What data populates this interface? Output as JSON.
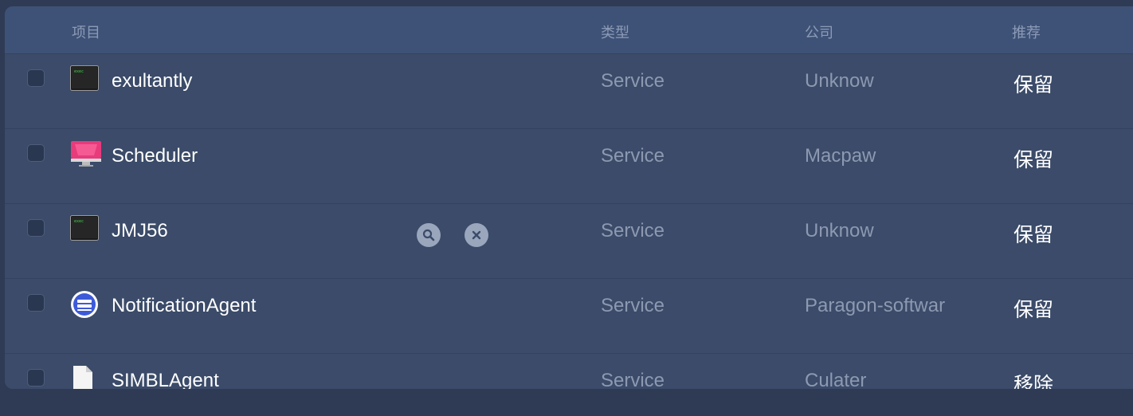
{
  "columns": {
    "item": "项目",
    "type": "类型",
    "company": "公司",
    "recommend": "推荐"
  },
  "rows": [
    {
      "name": "exultantly",
      "type": "Service",
      "company": "Unknow",
      "recommend": "保留",
      "icon": "terminal-icon"
    },
    {
      "name": "Scheduler",
      "type": "Service",
      "company": "Macpaw",
      "recommend": "保留",
      "icon": "cleanmymac-icon"
    },
    {
      "name": "JMJ56",
      "type": "Service",
      "company": "Unknow",
      "recommend": "保留",
      "icon": "terminal-icon"
    },
    {
      "name": "NotificationAgent",
      "type": "Service",
      "company": "Paragon-softwar",
      "recommend": "保留",
      "icon": "paragon-icon"
    },
    {
      "name": "SIMBLAgent",
      "type": "Service",
      "company": "Culater",
      "recommend": "移除",
      "icon": "document-icon"
    }
  ],
  "colors": {
    "background": "#2f3b55",
    "header": "#3e5277",
    "row": "#3b4b69"
  }
}
